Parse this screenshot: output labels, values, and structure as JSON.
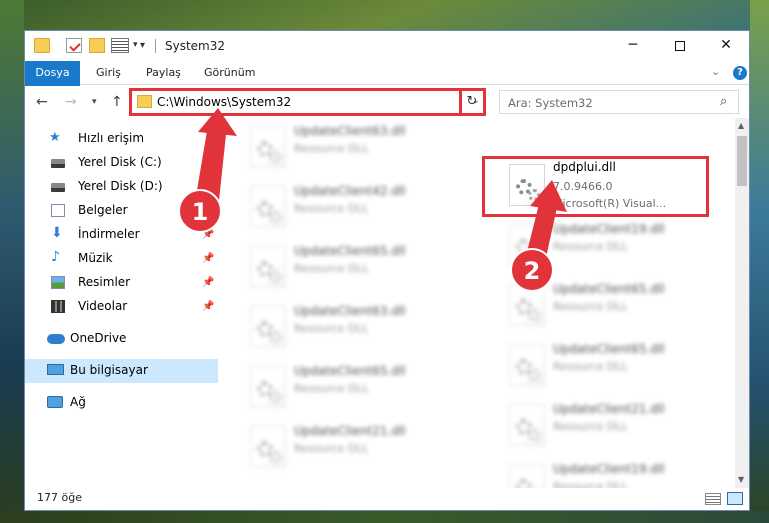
{
  "window": {
    "title": "System32"
  },
  "ribbon": {
    "tabs": [
      "Dosya",
      "Giriş",
      "Paylaş",
      "Görünüm"
    ],
    "help": "?"
  },
  "address": {
    "path": "C:\\Windows\\System32",
    "search_placeholder": "Ara: System32"
  },
  "sidebar": {
    "items": [
      {
        "label": "Hızlı erişim",
        "icon": "star-icon"
      },
      {
        "label": "Yerel Disk (C:)",
        "icon": "drive-icon"
      },
      {
        "label": "Yerel Disk (D:)",
        "icon": "drive-icon"
      },
      {
        "label": "Belgeler",
        "icon": "documents-icon"
      },
      {
        "label": "İndirmeler",
        "icon": "download-icon"
      },
      {
        "label": "Müzik",
        "icon": "music-icon"
      },
      {
        "label": "Resimler",
        "icon": "pictures-icon"
      },
      {
        "label": "Videolar",
        "icon": "videos-icon"
      },
      {
        "label": "OneDrive",
        "icon": "cloud-icon"
      },
      {
        "label": "Bu bilgisayar",
        "icon": "computer-icon"
      },
      {
        "label": "Ağ",
        "icon": "network-icon"
      }
    ]
  },
  "files": {
    "left": [
      {
        "name": "UpdateClient63.dll",
        "type": "Resource DLL"
      },
      {
        "name": "UpdateClient42.dll",
        "type": "Resource DLL"
      },
      {
        "name": "UpdateClient65.dll",
        "type": "Resource DLL"
      },
      {
        "name": "UpdateClient63.dll",
        "type": "Resource DLL"
      },
      {
        "name": "UpdateClient65.dll",
        "type": "Resource DLL"
      },
      {
        "name": "UpdateClient21.dll",
        "type": "Resource DLL"
      }
    ],
    "target": {
      "name": "dpdplui.dll",
      "version": "7.0.9466.0",
      "description": "Microsoft(R) Visual..."
    },
    "right": [
      {
        "name": "UpdateClient19.dll",
        "type": "Resource DLL"
      },
      {
        "name": "UpdateClient65.dll",
        "type": "Resource DLL"
      },
      {
        "name": "UpdateClient65.dll",
        "type": "Resource DLL"
      },
      {
        "name": "UpdateClient21.dll",
        "type": "Resource DLL"
      },
      {
        "name": "UpdateClient19.dll",
        "type": "Resource DLL"
      }
    ]
  },
  "status": {
    "item_count": "177 öğe"
  },
  "annotations": {
    "step1": "1",
    "step2": "2",
    "color": "#e0333a"
  }
}
